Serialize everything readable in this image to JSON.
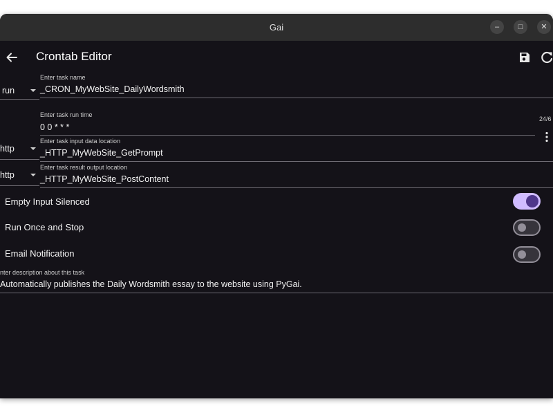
{
  "window": {
    "title": "Gai",
    "minimize_glyph": "–",
    "maximize_glyph": "□",
    "close_glyph": "✕"
  },
  "appbar": {
    "title": "Crontab Editor",
    "icons": [
      "back-arrow-icon",
      "save-icon",
      "refresh-icon"
    ]
  },
  "form": {
    "task_name": {
      "label": "Enter task name",
      "value": "_CRON_MyWebSite_DailyWordsmith",
      "type_value": "run"
    },
    "run_time": {
      "label": "Enter task run time",
      "value": "0 0 * * *",
      "counter": "24/6"
    },
    "input_location": {
      "label": "Enter task input data location",
      "value": "_HTTP_MyWebSite_GetPrompt",
      "type_value": "http"
    },
    "output_location": {
      "label": "Enter task result output location",
      "value": "_HTTP_MyWebSite_PostContent",
      "type_value": "http"
    },
    "toggles": [
      {
        "label": "Empty Input Silenced",
        "on": true
      },
      {
        "label": "Run Once and Stop",
        "on": false
      },
      {
        "label": "Email Notification",
        "on": false
      }
    ],
    "description": {
      "label": "nter description about this task",
      "value": "Automatically publishes the Daily Wordsmith essay to the website using PyGai."
    }
  },
  "colors": {
    "background": "#141218",
    "titlebar": "#2d2d2d",
    "switch_on_track": "#d0bcff",
    "switch_on_thumb": "#4f378b",
    "switch_off_outline": "#938f99"
  }
}
